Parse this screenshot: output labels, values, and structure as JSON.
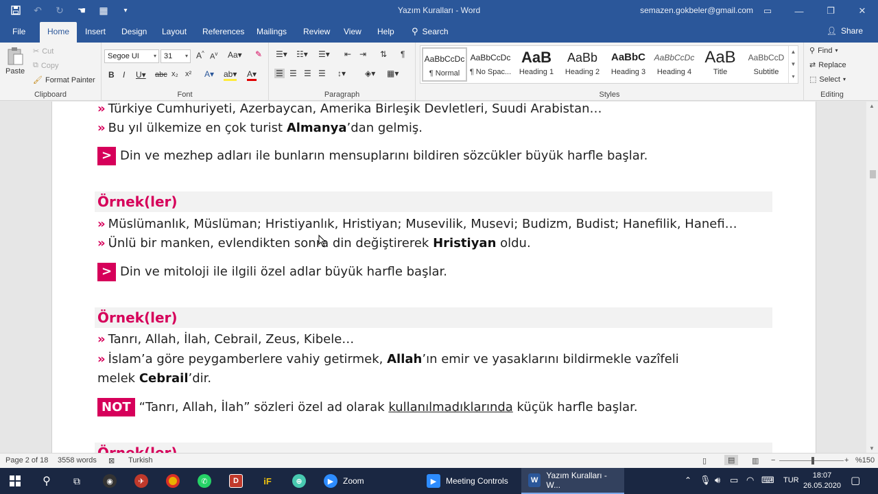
{
  "window": {
    "title": "Yazım Kuralları  -  Word",
    "account": "semazen.gokbeler@gmail.com"
  },
  "tabs": [
    "File",
    "Home",
    "Insert",
    "Design",
    "Layout",
    "References",
    "Mailings",
    "Review",
    "View",
    "Help"
  ],
  "search_label": "Search",
  "share_label": "Share",
  "ribbon": {
    "clipboard": {
      "paste": "Paste",
      "cut": "Cut",
      "copy": "Copy",
      "format_painter": "Format Painter",
      "label": "Clipboard"
    },
    "font": {
      "name": "Segoe UI",
      "size": "31",
      "label": "Font"
    },
    "paragraph": {
      "label": "Paragraph"
    },
    "styles": {
      "label": "Styles",
      "items": [
        {
          "sample": "AaBbCcDc",
          "name": "¶ Normal"
        },
        {
          "sample": "AaBbCcDc",
          "name": "¶ No Spac..."
        },
        {
          "sample": "AaB",
          "name": "Heading 1"
        },
        {
          "sample": "AaBb",
          "name": "Heading 2"
        },
        {
          "sample": "AaBbC",
          "name": "Heading 3"
        },
        {
          "sample": "AaBbCcDc",
          "name": "Heading 4"
        },
        {
          "sample": "AaB",
          "name": "Title"
        },
        {
          "sample": "AaBbCcD",
          "name": "Subtitle"
        }
      ]
    },
    "editing": {
      "find": "Find",
      "replace": "Replace",
      "select": "Select",
      "label": "Editing"
    }
  },
  "document": {
    "l1": "Türkiye Cumhuriyeti, Azerbaycan, Amerika Birleşik Devletleri, Suudi Arabistan…",
    "l2a": "Bu yıl ülkemize en çok turist ",
    "l2b": "Almanya",
    "l2c": "’dan gelmiş.",
    "rule1": "Din ve mezhep adları ile bunların mensuplarını bildiren sözcükler büyük harfle başlar.",
    "ornek": "Örnek(ler)",
    "l3": "Müslümanlık, Müslüman; Hristiyanlık, Hristiyan; Musevilik, Musevi; Budizm, Budist; Hanefilik, Hanefi…",
    "l4a": "Ünlü bir manken, evlendikten sonra din değiştirerek ",
    "l4b": "Hristiyan",
    "l4c": " oldu.",
    "rule2": "Din ve mitoloji ile ilgili özel adlar büyük harfle başlar.",
    "l5": "Tanrı, Allah, İlah, Cebrail, Zeus, Kibele…",
    "l6a": "İslam’a göre peygamberlere vahiy getirmek, ",
    "l6b": "Allah",
    "l6c": "’ın emir ve yasaklarını bildirmekle vazîfeli",
    "l7a": "melek ",
    "l7b": "Cebrail",
    "l7c": "’dir.",
    "not_label": "NOT",
    "note_a": "“Tanrı, Allah, İlah” sözleri özel ad olarak ",
    "note_b": "kullanılmadıklarında",
    "note_c": " küçük harfle başlar.",
    "bullet": "»",
    "gt": ">"
  },
  "status": {
    "page": "Page 2 of 18",
    "words": "3558 words",
    "language": "Turkish",
    "zoom": "%150"
  },
  "taskbar": {
    "zoom_app": "Zoom",
    "meeting_app": "Meeting Controls",
    "word_app": "Yazım Kuralları - W...",
    "lang": "TUR",
    "time": "18:07",
    "date": "26.05.2020"
  },
  "colors": {
    "accent": "#d6005a",
    "word_blue": "#2b579a"
  }
}
